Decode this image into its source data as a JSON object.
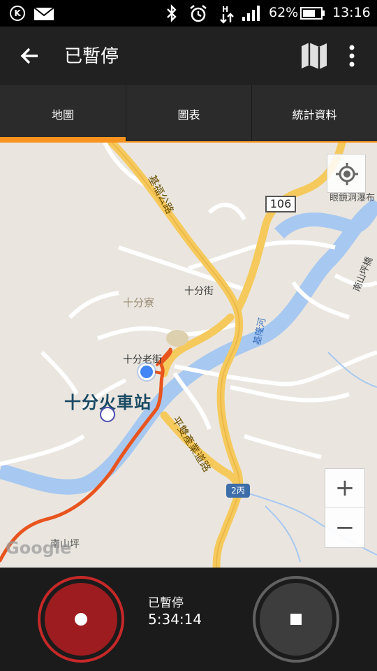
{
  "status_bar": {
    "k_badge": "K",
    "battery_percent": "62%",
    "time": "13:16"
  },
  "app_bar": {
    "title": "已暫停"
  },
  "tabs": [
    {
      "label": "地圖",
      "selected": true
    },
    {
      "label": "圖表",
      "selected": false
    },
    {
      "label": "統計資料",
      "selected": false
    }
  ],
  "map": {
    "labels": {
      "station": "十分火車站",
      "old_street": "十分老街",
      "shifen_liao": "十分寮",
      "shifen_street": "十分街",
      "nanshan": "南山坪",
      "waterfall": "眼鏡洞瀑布",
      "jifu_road": "基福公路",
      "pingshuang_road": "平雙產業道路",
      "keelung_river": "基隆河",
      "nanshan_road": "南山坪橋"
    },
    "route_106": "106",
    "route_2": "2丙",
    "google": "Google",
    "zoom_in": "+",
    "zoom_out": "−"
  },
  "bottom": {
    "status": "已暫停",
    "elapsed": "5:34:14"
  },
  "colors": {
    "accent": "#f7931e",
    "record": "#c62828",
    "route": "#e8541e"
  }
}
